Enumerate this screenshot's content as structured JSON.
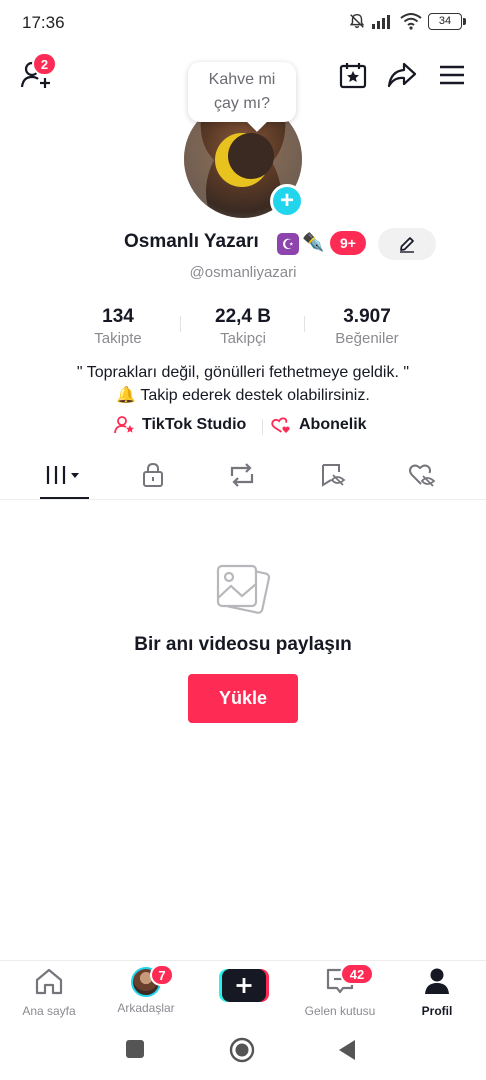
{
  "status_bar": {
    "time": "17:36",
    "battery": "34"
  },
  "header": {
    "friend_requests_badge": "2"
  },
  "bubble": {
    "line1": "Kahve mi",
    "line2": "çay mı?"
  },
  "profile": {
    "display_name": "Osmanlı Yazarı",
    "name_emoji_1": "☪",
    "name_emoji_2": "✒️",
    "notifications_badge": "9+",
    "username": "@osmanliyazari"
  },
  "stats": [
    {
      "value": "134",
      "label": "Takipte"
    },
    {
      "value": "22,4 B",
      "label": "Takipçi"
    },
    {
      "value": "3.907",
      "label": "Beğeniler"
    }
  ],
  "bio": {
    "line1": "\" Toprakları değil, gönülleri fethetmeye geldik. \"",
    "line2": "🔔 Takip ederek destek olabilirsiniz."
  },
  "links": {
    "studio": "TikTok Studio",
    "subscription": "Abonelik"
  },
  "tabs": [
    "videos-grid-icon",
    "lock-icon",
    "repost-icon",
    "favorites-icon",
    "liked-icon"
  ],
  "empty_state": {
    "title": "Bir anı videosu paylaşın",
    "button": "Yükle"
  },
  "bottom_nav": {
    "home": "Ana sayfa",
    "friends": "Arkadaşlar",
    "friends_badge": "7",
    "inbox": "Gelen kutusu",
    "inbox_badge": "42",
    "profile": "Profil"
  },
  "colors": {
    "accent": "#fe2c55",
    "cyan": "#20d5ec",
    "text": "#161823",
    "secondary": "#8a8b91"
  }
}
